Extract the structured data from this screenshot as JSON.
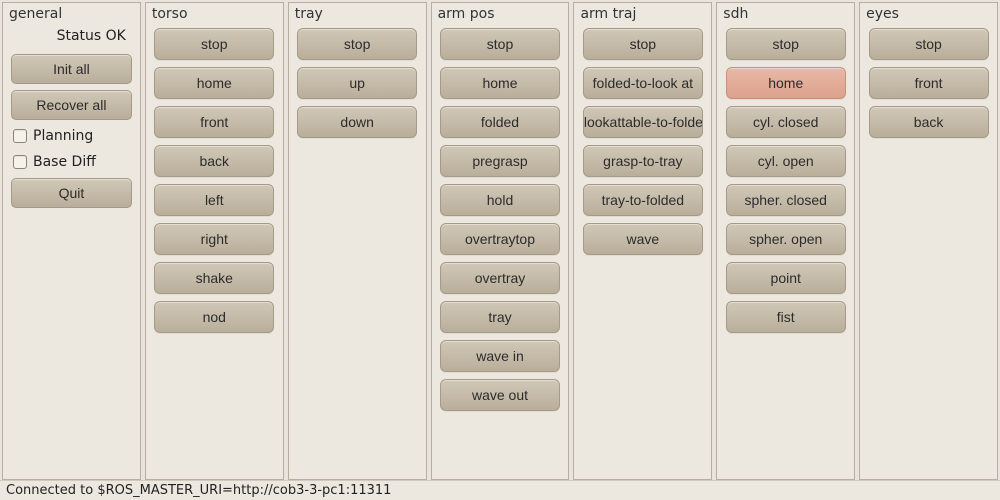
{
  "general": {
    "title": "general",
    "status": "Status OK",
    "buttons_top": [
      "Init all",
      "Recover all"
    ],
    "checkboxes": [
      "Planning",
      "Base Diff"
    ],
    "buttons_bottom": [
      "Quit"
    ]
  },
  "columns": [
    {
      "title": "torso",
      "buttons": [
        "stop",
        "home",
        "front",
        "back",
        "left",
        "right",
        "shake",
        "nod"
      ],
      "highlight": null
    },
    {
      "title": "tray",
      "buttons": [
        "stop",
        "up",
        "down"
      ],
      "highlight": null
    },
    {
      "title": "arm pos",
      "buttons": [
        "stop",
        "home",
        "folded",
        "pregrasp",
        "hold",
        "overtraytop",
        "overtray",
        "tray",
        "wave in",
        "wave out"
      ],
      "highlight": null
    },
    {
      "title": "arm traj",
      "buttons": [
        "stop",
        "folded-to-look at",
        "lookattable-to-folded",
        "grasp-to-tray",
        "tray-to-folded",
        "wave"
      ],
      "highlight": null
    },
    {
      "title": "sdh",
      "buttons": [
        "stop",
        "home",
        "cyl. closed",
        "cyl. open",
        "spher. closed",
        "spher. open",
        "point",
        "fist"
      ],
      "highlight": 1
    },
    {
      "title": "eyes",
      "buttons": [
        "stop",
        "front",
        "back"
      ],
      "highlight": null
    }
  ],
  "statusbar": "Connected to $ROS_MASTER_URI=http://cob3-3-pc1:11311"
}
